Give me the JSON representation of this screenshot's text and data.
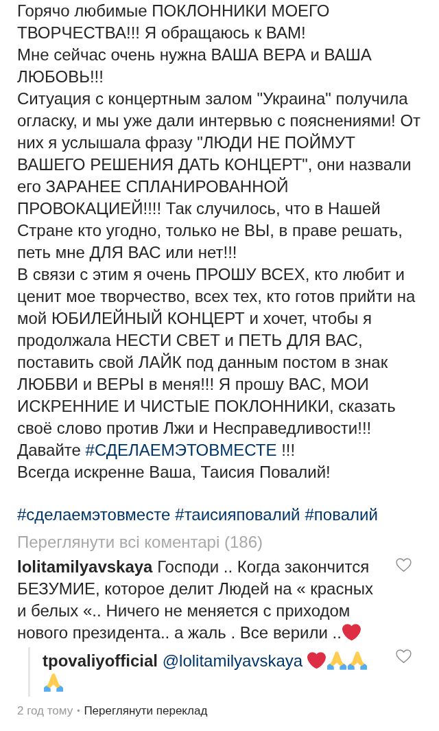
{
  "caption": {
    "paragraphs": [
      {
        "parts": [
          {
            "kind": "text",
            "text": "Горячо любимые ПОКЛОННИКИ МОЕГО ТВОРЧЕСТВА!!! Я обращаюсь к ВАМ!"
          }
        ]
      },
      {
        "parts": [
          {
            "kind": "text",
            "text": "Мне сейчас очень нужна ВАША ВЕРА и ВАША ЛЮБОВЬ!!!"
          }
        ]
      },
      {
        "parts": [
          {
            "kind": "text",
            "text": "Ситуация с концертным залом \"Украина\" получила огласку, и мы уже дали интервью с пояснениями! От них я услышала фразу \"ЛЮДИ НЕ ПОЙМУТ ВАШЕГО РЕШЕНИЯ ДАТЬ КОНЦЕРТ\", они назвали его ЗАРАНЕЕ СПЛАНИРОВАННОЙ ПРОВОКАЦИЕЙ!!!! Так случилось, что в Нашей Стране кто угодно, только не ВЫ, в праве решать, петь мне ДЛЯ ВАС или нет!!!"
          }
        ]
      },
      {
        "parts": [
          {
            "kind": "text",
            "text": "В связи с этим я очень ПРОШУ ВСЕХ, кто любит и ценит мое творчество, всех тех, кто готов прийти на мой ЮБИЛЕЙНЫЙ КОНЦЕРТ и хочет, чтобы я продолжала НЕСТИ СВЕТ и ПЕТЬ ДЛЯ ВАС, поставить свой ЛАЙК под данным постом в знак ЛЮБВИ и ВЕРЫ в меня!!! Я прошу ВАС, МОИ ИСКРЕННИЕ И ЧИСТЫЕ ПОКЛОННИКИ, сказать своё слово против Лжи и Несправедливости!!!"
          }
        ]
      },
      {
        "parts": [
          {
            "kind": "text",
            "text": "Давайте"
          },
          {
            "kind": "hashtag",
            "text": "#СДЕЛАЕМЭТОВМЕСТЕ"
          },
          {
            "kind": "text",
            "text": "!!!"
          }
        ]
      },
      {
        "parts": [
          {
            "kind": "text",
            "text": "Всегда искренне Ваша, Таисия Повалий!"
          }
        ]
      }
    ],
    "hashtags": [
      "#сделаемэтовместе",
      "#таисияповалий",
      "#повалий"
    ]
  },
  "view_all_comments": "Переглянути всі коментарі (186)",
  "comments": [
    {
      "username": "lolitamilyavskaya",
      "liked": false,
      "parts": [
        {
          "kind": "text",
          "text": "Господи .. Когда закончится БЕЗУМИЕ, которое делит Людей на « красных и белых «.. Ничего не меняется с приходом нового президента.. а жаль . Все верили .."
        },
        {
          "kind": "heart"
        }
      ],
      "replies": [
        {
          "username": "tpovaliyofficial",
          "liked": false,
          "parts": [
            {
              "kind": "mention",
              "text": "@lolitamilyavskaya"
            },
            {
              "kind": "heart"
            },
            {
              "kind": "folded_hands"
            },
            {
              "kind": "folded_hands"
            },
            {
              "kind": "folded_hands"
            }
          ]
        }
      ]
    }
  ],
  "post_meta": {
    "time": "2 год тому",
    "separator": "•",
    "translate_link": "Переглянути переклад"
  }
}
